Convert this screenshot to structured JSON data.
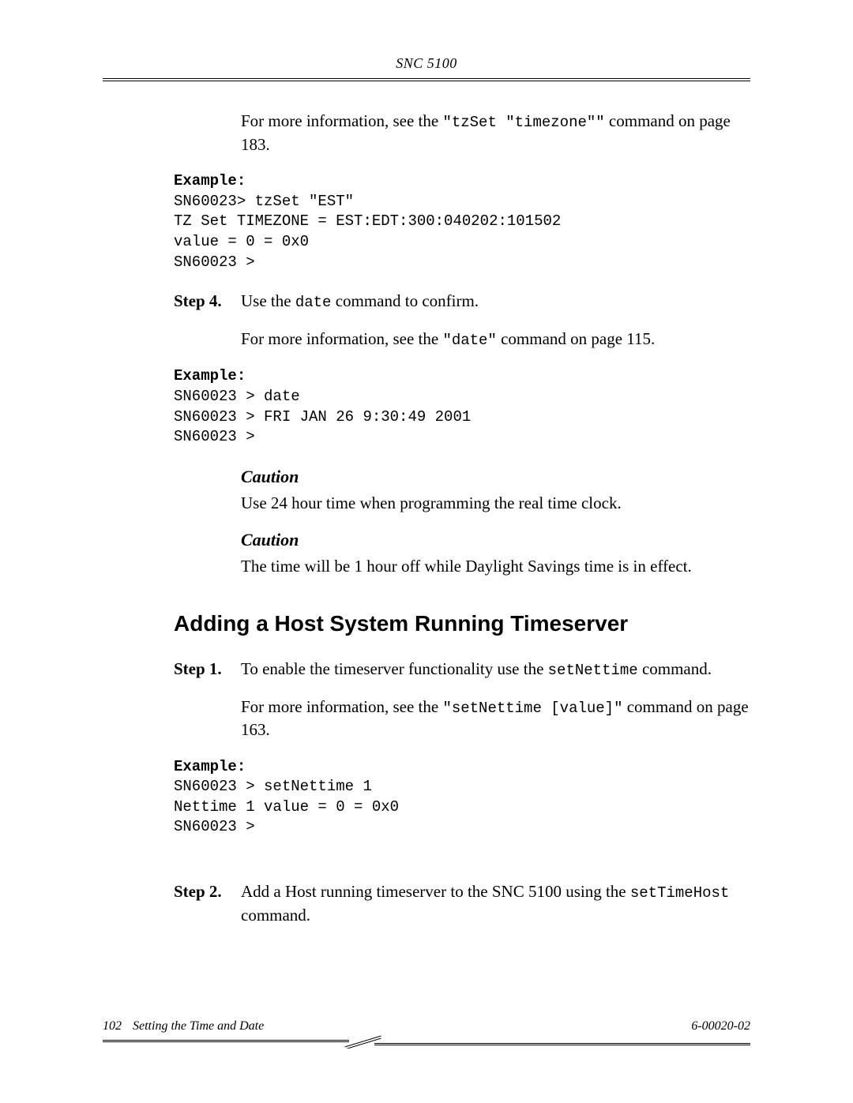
{
  "header": {
    "title": "SNC 5100"
  },
  "intro": {
    "line1_pre": "For more information, see the ",
    "line1_cmd": "\"tzSet \"timezone\"\"",
    "line1_post": " command on page 183."
  },
  "example1": {
    "label": "Example:",
    "code": "SN60023> tzSet \"EST\"\nTZ Set TIMEZONE = EST:EDT:300:040202:101502\nvalue = 0 = 0x0\nSN60023 >"
  },
  "step4": {
    "label": "Step 4.",
    "line_pre": "Use the ",
    "cmd": "date",
    "line_post": " command to confirm.",
    "info_pre": "For more information, see the ",
    "info_cmd": "\"date\"",
    "info_post": " command on page 115."
  },
  "example2": {
    "label": "Example:",
    "code": "SN60023 > date\nSN60023 > FRI JAN 26 9:30:49 2001\nSN60023 >"
  },
  "caution1": {
    "heading": "Caution",
    "text": "Use 24 hour time when programming the real time clock."
  },
  "caution2": {
    "heading": "Caution",
    "text": "The time will be 1 hour off while Daylight Savings time is in effect."
  },
  "section": {
    "heading": "Adding a Host System Running Timeserver"
  },
  "step1": {
    "label": "Step 1.",
    "line_pre": "To enable the timeserver functionality use the ",
    "cmd": "setNettime",
    "line_post": " command.",
    "info_pre": "For more information, see the ",
    "info_cmd": "\"setNettime [value]\"",
    "info_post": " command on page 163."
  },
  "example3": {
    "label": "Example:",
    "code": "SN60023 > setNettime 1\nNettime 1 value = 0 = 0x0\nSN60023 >"
  },
  "step2": {
    "label": "Step 2.",
    "line_pre": "Add a Host running timeserver to the SNC 5100 using the ",
    "cmd": "setTimeHost",
    "line_post": " command."
  },
  "footer": {
    "page": "102",
    "title": "Setting the Time and Date",
    "docnum": "6-00020-02"
  }
}
